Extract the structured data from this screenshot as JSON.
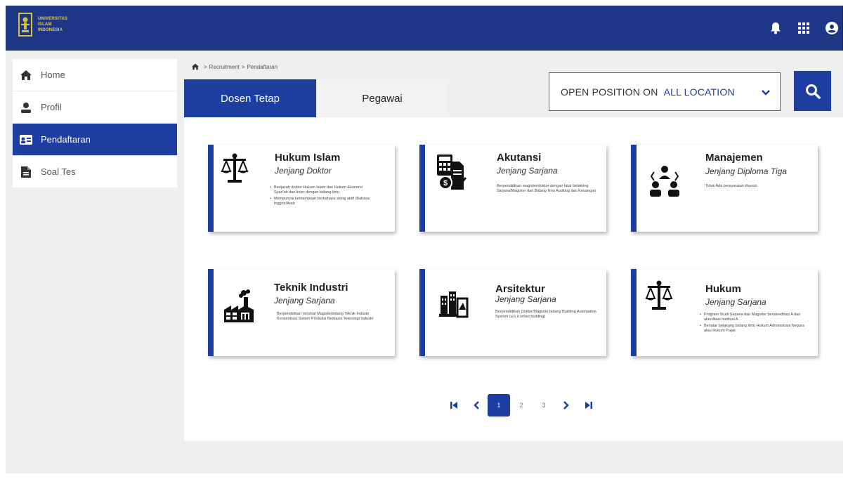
{
  "brand": {
    "line1": "UNIVERSITAS",
    "line2": "ISLAM",
    "line3": "INDONESIA"
  },
  "sidebar": {
    "items": [
      {
        "label": "Home",
        "icon": "home-icon"
      },
      {
        "label": "Profil",
        "icon": "user-icon"
      },
      {
        "label": "Pendaftaran",
        "icon": "id-card-icon",
        "active": true
      },
      {
        "label": "Soal Tes",
        "icon": "document-icon"
      }
    ]
  },
  "breadcrumb": {
    "sep1": ">",
    "item1": "Recruitment",
    "sep2": ">",
    "item2": "Pendaftaran"
  },
  "tabs": [
    {
      "label": "Dosen Tetap",
      "active": true
    },
    {
      "label": "Pegawai",
      "active": false
    }
  ],
  "location": {
    "label": "OPEN POSITION ON",
    "value": "ALL LOCATION"
  },
  "cards": [
    {
      "title": "Hukum Islam",
      "level": "Jenjang Doktor",
      "icon": "scale-icon",
      "bullets": [
        "Berijazah doktor Hukum Islam dan Hukum Ekonomi Syari'ah dan linier dengan bidang ilmu",
        "Mempunyai kemampuan berbahasa asing aktif (Bahasa Inggris/Arab"
      ]
    },
    {
      "title": "Akutansi",
      "level": "Jenjang Sarjana",
      "icon": "accounting-icon",
      "text": "Berpendidikan magister/doktor dengan latar belakang Sarjana/Magister dari Bidang Ilmu Auditing dan Keuangan"
    },
    {
      "title": "Manajemen",
      "level": "Jenjang Diploma Tiga",
      "icon": "management-icon",
      "text": "Tidak Ada persyaratan khusus"
    },
    {
      "title": "Teknik Industri",
      "level": "Jenjang Sarjana",
      "icon": "factory-icon",
      "text": "Berpendidikan minimal Magisterbidang Teknik Industri Konsentrasi Sistem Produksi Berbasis Teknologi Industri"
    },
    {
      "title": "Arsitektur",
      "level": "Jenjang Sarjana",
      "icon": "architecture-icon",
      "text": "Berpendidikan Doktor/Magister bidang Building Automation System (a.k.a smart building)"
    },
    {
      "title": "Hukum",
      "level": "Jenjang Sarjana",
      "icon": "scale-icon",
      "bullets": [
        "Program Studi Sarjana dan Magister berakreditasi A dan akreditasi Institusi A",
        "Berlatar belakang bidang Ilmu Hukum Administrasi Negara atau Hukum Pajak"
      ]
    }
  ],
  "pagination": {
    "pages": [
      "1",
      "2",
      "3"
    ],
    "current": "1"
  },
  "colors": {
    "topbar": "#1d3685",
    "accent": "#1d3ea0",
    "logo_text": "#e5d23c"
  }
}
